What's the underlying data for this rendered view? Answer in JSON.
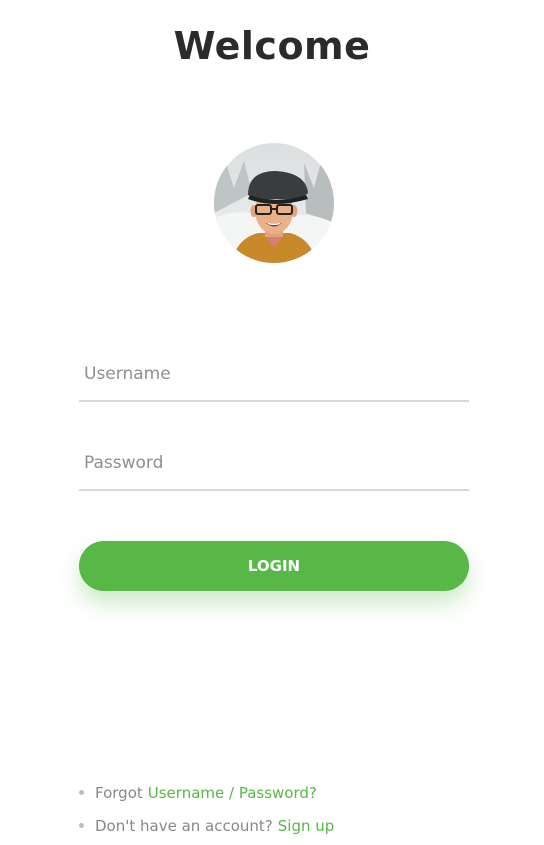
{
  "header": {
    "title": "Welcome"
  },
  "avatar": {
    "icon": "user-photo-avatar"
  },
  "form": {
    "username": {
      "placeholder": "Username",
      "value": ""
    },
    "password": {
      "placeholder": "Password",
      "value": ""
    },
    "login_label": "LOGIN"
  },
  "footer": {
    "forgot_prefix": "Forgot",
    "forgot_link": "Username / Password?",
    "signup_prefix": "Don't have an account?",
    "signup_link": "Sign up"
  },
  "colors": {
    "accent": "#57b846",
    "title": "#2b2b2b",
    "muted_text": "#888888",
    "underline": "#d9d9d9"
  }
}
